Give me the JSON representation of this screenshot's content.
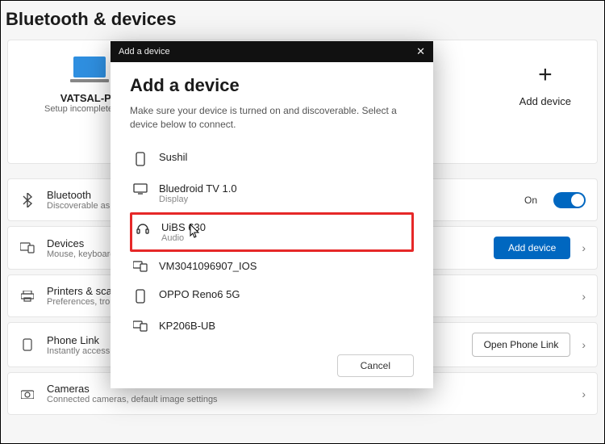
{
  "page": {
    "title": "Bluetooth & devices"
  },
  "pc": {
    "name": "VATSAL-PC",
    "subtitle": "Setup incomplete beca"
  },
  "add_device_card": {
    "label": "Add device"
  },
  "rows": {
    "bluetooth": {
      "title": "Bluetooth",
      "subtitle": "Discoverable as \"VA",
      "state": "On"
    },
    "devices": {
      "title": "Devices",
      "subtitle": "Mouse, keyboard, pe",
      "button": "Add device"
    },
    "printers": {
      "title": "Printers & scanner",
      "subtitle": "Preferences, troubles"
    },
    "phone": {
      "title": "Phone Link",
      "subtitle": "Instantly access your",
      "button": "Open Phone Link"
    },
    "cameras": {
      "title": "Cameras",
      "subtitle": "Connected cameras, default image settings"
    }
  },
  "dialog": {
    "titlebar": "Add a device",
    "heading": "Add a device",
    "subtitle": "Make sure your device is turned on and discoverable. Select a device below to connect.",
    "devices": [
      {
        "name": "Sushil",
        "type": "",
        "icon": "phone"
      },
      {
        "name": "Bluedroid TV 1.0",
        "type": "Display",
        "icon": "display"
      },
      {
        "name": "UiBS 630",
        "type": "Audio",
        "icon": "audio"
      },
      {
        "name": "VM3041096907_IOS",
        "type": "",
        "icon": "device"
      },
      {
        "name": "OPPO Reno6 5G",
        "type": "",
        "icon": "phone"
      },
      {
        "name": "KP206B-UB",
        "type": "",
        "icon": "device"
      }
    ],
    "cancel": "Cancel"
  }
}
